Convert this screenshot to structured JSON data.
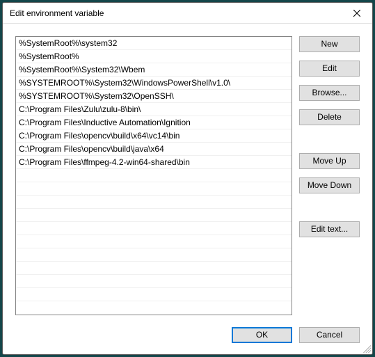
{
  "title": "Edit environment variable",
  "list_items": [
    "%SystemRoot%\\system32",
    "%SystemRoot%",
    "%SystemRoot%\\System32\\Wbem",
    "%SYSTEMROOT%\\System32\\WindowsPowerShell\\v1.0\\",
    "%SYSTEMROOT%\\System32\\OpenSSH\\",
    "C:\\Program Files\\Zulu\\zulu-8\\bin\\",
    "C:\\Program Files\\Inductive Automation\\Ignition",
    "C:\\Program Files\\opencv\\build\\x64\\vc14\\bin",
    "C:\\Program Files\\opencv\\build\\java\\x64",
    "C:\\Program Files\\ffmpeg-4.2-win64-shared\\bin"
  ],
  "buttons": {
    "new": "New",
    "edit": "Edit",
    "browse": "Browse...",
    "delete": "Delete",
    "move_up": "Move Up",
    "move_down": "Move Down",
    "edit_text": "Edit text...",
    "ok": "OK",
    "cancel": "Cancel"
  }
}
